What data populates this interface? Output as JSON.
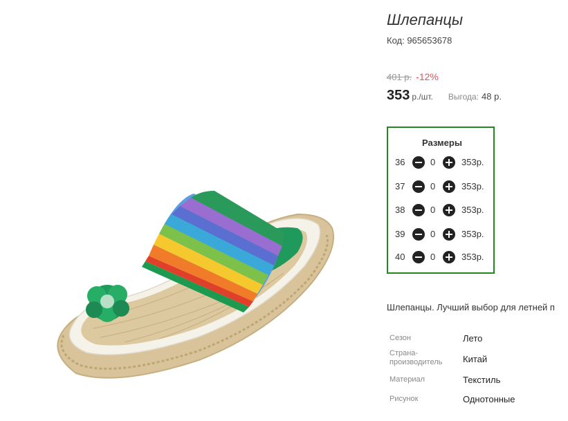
{
  "product": {
    "title": "Шлепанцы",
    "code": "Код: 965653678",
    "old_price": "401 р.",
    "discount": "-12%",
    "price": "353",
    "price_unit": "р./шт.",
    "benefit_label": "Выгода:",
    "benefit_value": "48 р."
  },
  "sizes": {
    "title": "Размеры",
    "rows": [
      {
        "size": "36",
        "qty": "0",
        "price": "353р."
      },
      {
        "size": "37",
        "qty": "0",
        "price": "353р."
      },
      {
        "size": "38",
        "qty": "0",
        "price": "353р."
      },
      {
        "size": "39",
        "qty": "0",
        "price": "353р."
      },
      {
        "size": "40",
        "qty": "0",
        "price": "353р."
      }
    ]
  },
  "description": "Шлепанцы. Лучший выбор для летней п",
  "attributes": [
    {
      "label": "Сезон",
      "value": "Лето"
    },
    {
      "label": "Страна-производитель",
      "value": "Китай"
    },
    {
      "label": "Материал",
      "value": "Текстиль"
    },
    {
      "label": "Рисунок",
      "value": "Однотонные"
    }
  ],
  "colors": {
    "sizes_border": "#1e8a1e",
    "discount": "#e8505b"
  },
  "icons": {
    "minus": "minus-circle-icon",
    "plus": "plus-circle-icon"
  }
}
